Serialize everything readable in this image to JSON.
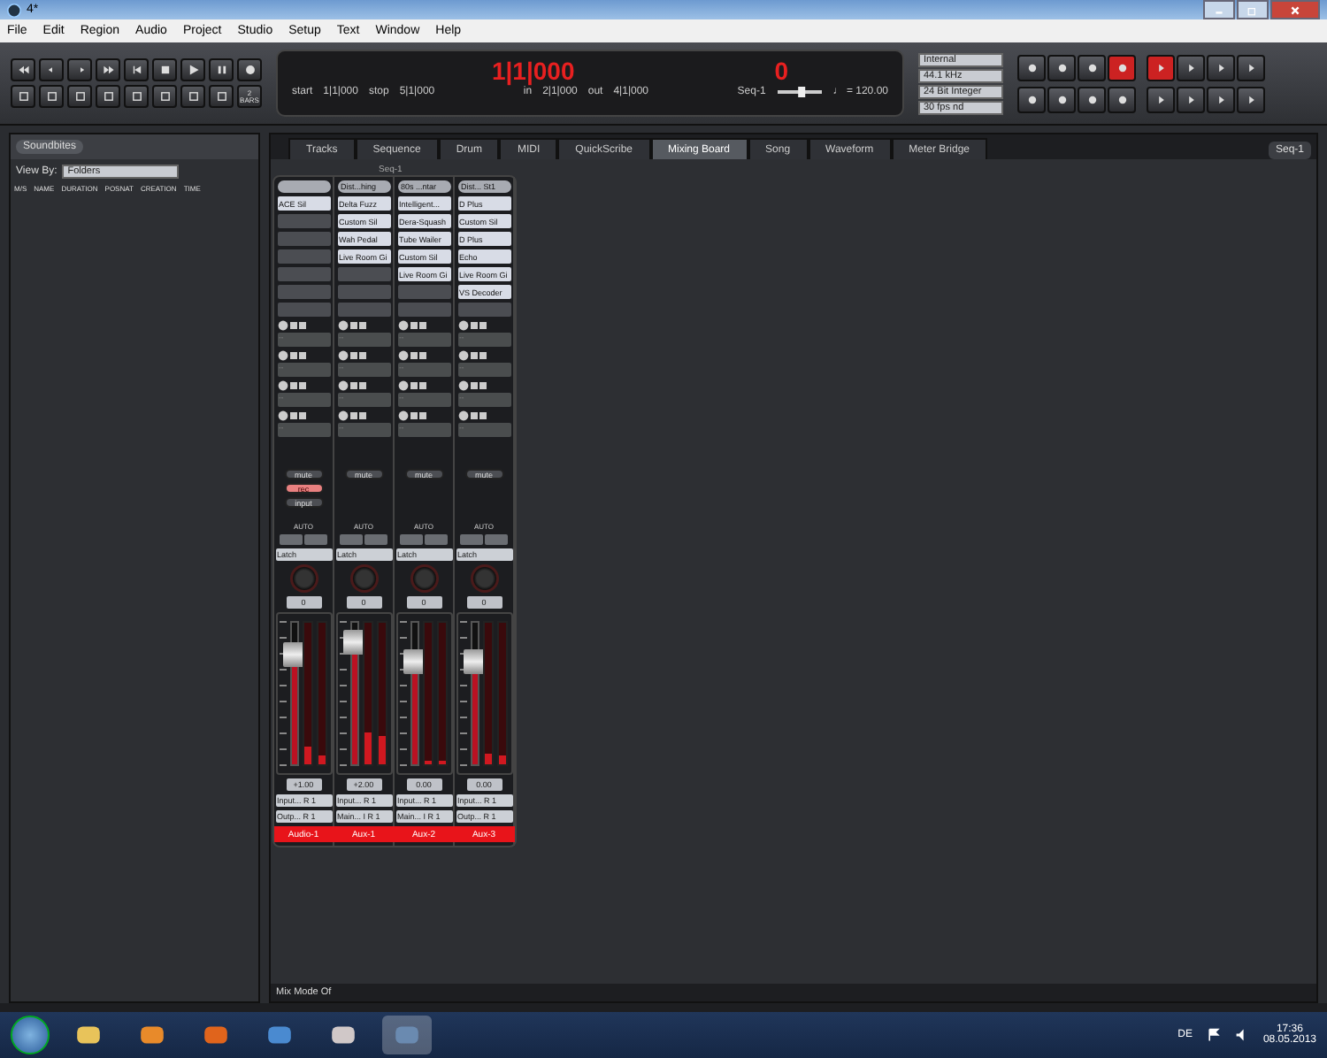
{
  "window": {
    "title": "4*"
  },
  "menu": [
    "File",
    "Edit",
    "Region",
    "Audio",
    "Project",
    "Studio",
    "Setup",
    "Text",
    "Window",
    "Help"
  ],
  "toolbar": {
    "bars_count": "2",
    "bars_unit": "BARS",
    "counter": "1|1|000",
    "start_label": "start",
    "start": "1|1|000",
    "stop_label": "stop",
    "stop": "5|1|000",
    "in_label": "in",
    "in": "2|1|000",
    "out_label": "out",
    "out": "4|1|000",
    "transpose": "0",
    "sequence": "Seq-1",
    "tempo": "♩ = 120.00",
    "tempo_slider": {
      "level": 0.55
    },
    "sync_options": [
      "Internal",
      "44.1 kHz",
      "24 Bit Integer",
      "30 fps nd"
    ]
  },
  "soundbites": {
    "tab": "Soundbites",
    "view_by_label": "View By:",
    "view_by": "Folders",
    "columns": [
      "M/S",
      "NAME",
      "DURATION",
      "POSNAT",
      "CREATION",
      "TIME"
    ]
  },
  "tabs": [
    {
      "label": "Tracks",
      "selected": false
    },
    {
      "label": "Sequence",
      "selected": false
    },
    {
      "label": "Drum",
      "selected": false
    },
    {
      "label": "MIDI",
      "selected": false
    },
    {
      "label": "QuickScribe",
      "selected": false
    },
    {
      "label": "Mixing Board",
      "selected": true
    },
    {
      "label": "Song",
      "selected": false
    },
    {
      "label": "Waveform",
      "selected": false
    },
    {
      "label": "Meter Bridge",
      "selected": false
    }
  ],
  "sequence_menu": "Seq-1",
  "mixer": {
    "title": "Seq-1",
    "strips": [
      {
        "name": "Audio-1",
        "color": "#e8141a",
        "inserts": [
          "ACE Sil"
        ],
        "sends": [
          "--",
          "--",
          "--",
          "--"
        ],
        "buttons": [
          {
            "label": "mute",
            "on": false
          },
          {
            "label": "rec",
            "on": true
          },
          {
            "label": "input",
            "on": false
          }
        ],
        "auto_label": "AUTO",
        "automation": "Latch",
        "pan": "0",
        "fader": "+1.00",
        "level": 0.78,
        "meters": [
          {
            "level": 0.12
          },
          {
            "level": 0.06
          }
        ],
        "input": "Input... R 1",
        "output": "Outp... R 1"
      },
      {
        "name": "Aux-1",
        "color": "#e8141a",
        "preset": "Dist...hing",
        "inserts": [
          "Delta Fuzz",
          "Custom Sil",
          "Wah Pedal",
          "Live Room Gi"
        ],
        "sends": [
          "--",
          "--",
          "--",
          "--"
        ],
        "buttons": [
          {
            "label": "mute",
            "on": false
          }
        ],
        "auto_label": "AUTO",
        "automation": "Latch",
        "pan": "0",
        "fader": "+2.00",
        "level": 0.86,
        "meters": [
          {
            "level": 0.22
          },
          {
            "level": 0.2
          }
        ],
        "input": "Input... R 1",
        "output": "Main... I R 1"
      },
      {
        "name": "Aux-2",
        "color": "#e8141a",
        "preset": "80s ...ntar",
        "inserts": [
          "Intelligent...",
          "Dera-Squash",
          "Tube Wailer",
          "Custom Sil",
          "Live Room Gi"
        ],
        "sends": [
          "--",
          "--",
          "--",
          "--"
        ],
        "buttons": [
          {
            "label": "mute",
            "on": false
          }
        ],
        "auto_label": "AUTO",
        "automation": "Latch",
        "pan": "0",
        "fader": "0.00",
        "level": 0.72,
        "meters": [
          {
            "level": 0.02
          },
          {
            "level": 0.02
          }
        ],
        "input": "Input... R 1",
        "output": "Main... I R 1"
      },
      {
        "name": "Aux-3",
        "color": "#e8141a",
        "preset": "Dist... St1",
        "inserts": [
          "D Plus",
          "Custom Sil",
          "D Plus",
          "Echo",
          "Live Room Gi",
          "VS Decoder"
        ],
        "sends": [
          "--",
          "--",
          "--",
          "--"
        ],
        "buttons": [
          {
            "label": "mute",
            "on": false
          }
        ],
        "auto_label": "AUTO",
        "automation": "Latch",
        "pan": "0",
        "fader": "0.00",
        "level": 0.72,
        "meters": [
          {
            "level": 0.08
          },
          {
            "level": 0.06
          }
        ],
        "input": "Input... R 1",
        "output": "Outp... R 1"
      }
    ]
  },
  "bottom_bar": {
    "mode": "Mix Mode Of"
  },
  "taskbar": {
    "language": "DE",
    "time": "17:36",
    "date": "08.05.2013"
  }
}
